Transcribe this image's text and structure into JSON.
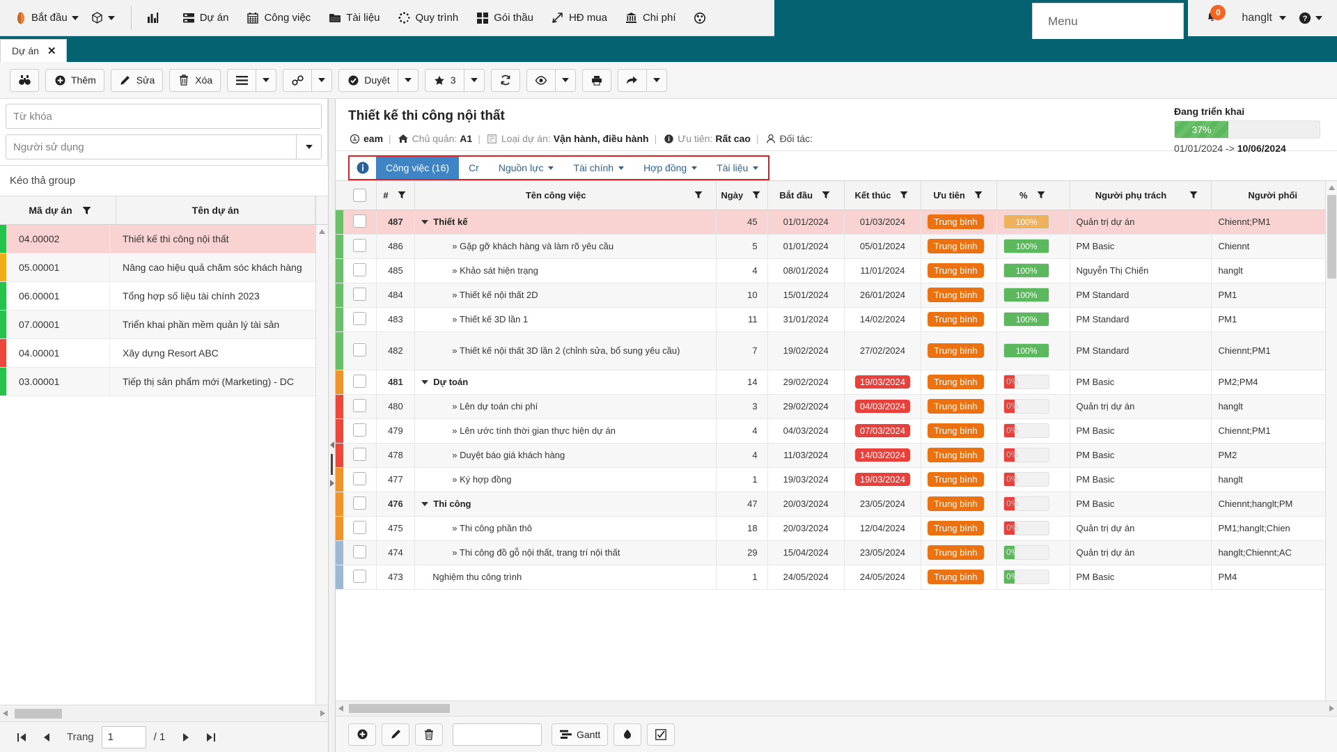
{
  "topnav": {
    "start_label": "Bắt đầu",
    "cube_label": "",
    "items": [
      {
        "label": "",
        "icon": "bar-chart-icon",
        "name": "nav-item-dashboard"
      },
      {
        "label": "Dự án",
        "icon": "projects-icon",
        "name": "nav-item-projects"
      },
      {
        "label": "Công việc",
        "icon": "calendar-icon",
        "name": "nav-item-tasks"
      },
      {
        "label": "Tài liệu",
        "icon": "folder-icon",
        "name": "nav-item-documents"
      },
      {
        "label": "Quy trình",
        "icon": "process-icon",
        "name": "nav-item-process"
      },
      {
        "label": "Gói thầu",
        "icon": "grid-icon",
        "name": "nav-item-packages"
      },
      {
        "label": "HĐ mua",
        "icon": "contract-icon",
        "name": "nav-item-purchase"
      },
      {
        "label": "Chi phí",
        "icon": "bank-icon",
        "name": "nav-item-cost"
      },
      {
        "label": "",
        "icon": "gauge-icon",
        "name": "nav-item-gauge"
      }
    ],
    "menu_label": "Menu",
    "notification_count": "0",
    "user": "hanglt"
  },
  "doc_tab": {
    "label": "Dự án",
    "close": "✕"
  },
  "toolbar": {
    "search_icon": "binoculars-icon",
    "add_label": "Thêm",
    "edit_label": "Sửa",
    "delete_label": "Xóa",
    "approve_label": "Duyệt",
    "star_count": "3"
  },
  "left": {
    "keyword_placeholder": "Từ khóa",
    "keyword_value": "",
    "user_placeholder": "Người sử dụng",
    "user_value": "",
    "group_hint": "Kéo thả group",
    "columns": [
      "Mã dự án",
      "Tên dự án"
    ],
    "rows": [
      {
        "code": "04.00002",
        "name": "Thiết kế thi công nội thất",
        "bar": "#27c24c",
        "selected": true
      },
      {
        "code": "05.00001",
        "name": "Nâng cao hiệu quả chăm sóc khách hàng",
        "bar": "#f0ad17",
        "selected": false
      },
      {
        "code": "06.00001",
        "name": "Tổng hợp số liệu tài chính 2023",
        "bar": "#27c24c",
        "selected": false
      },
      {
        "code": "07.00001",
        "name": "Triển khai phần mềm quản lý tài sản",
        "bar": "#27c24c",
        "selected": false
      },
      {
        "code": "04.00001",
        "name": "Xây dựng Resort ABC",
        "bar": "#e8493a",
        "selected": false
      },
      {
        "code": "03.00001",
        "name": "Tiếp thị sản phẩm mới (Marketing) - DC",
        "bar": "#27c24c",
        "selected": false
      }
    ],
    "pager": {
      "label": "Trang",
      "page": "1",
      "total": "/ 1"
    }
  },
  "project": {
    "title": "Thiết kế thi công nội thất",
    "team": "eam",
    "owner_label": "Chủ quản:",
    "owner": "A1",
    "type_label": "Loại dự án:",
    "type": "Vận hành, điều hành",
    "priority_label": "Ưu tiên:",
    "priority": "Rất cao",
    "partner_label": "Đối tác:",
    "partner": "",
    "status_title": "Đang triển khai",
    "progress": "37%",
    "progress_value": 37,
    "date_start": "01/01/2024",
    "date_arrow": "->",
    "date_end": "10/06/2024"
  },
  "subtabs": [
    {
      "label": "Công việc (16)",
      "active": true,
      "caret": false,
      "name": "tab-tasks"
    },
    {
      "label": "Cr",
      "active": false,
      "caret": false,
      "name": "tab-cr"
    },
    {
      "label": "Nguồn lực",
      "active": false,
      "caret": true,
      "name": "tab-resources"
    },
    {
      "label": "Tài chính",
      "active": false,
      "caret": true,
      "name": "tab-finance"
    },
    {
      "label": "Hợp đồng",
      "active": false,
      "caret": true,
      "name": "tab-contracts"
    },
    {
      "label": "Tài liệu",
      "active": false,
      "caret": true,
      "name": "tab-documents"
    }
  ],
  "grid": {
    "columns": [
      {
        "label": "#",
        "filter": true
      },
      {
        "label": "Tên công việc",
        "filter": true
      },
      {
        "label": "Ngày",
        "filter": true
      },
      {
        "label": "Bắt đầu",
        "filter": true
      },
      {
        "label": "Kết thúc",
        "filter": true
      },
      {
        "label": "Ưu tiên",
        "filter": true
      },
      {
        "label": "%",
        "filter": true
      },
      {
        "label": "Người phụ trách",
        "filter": true
      },
      {
        "label": "Người phối",
        "filter": false
      }
    ],
    "rows": [
      {
        "bar": "#6ac06a",
        "num": "487",
        "name": "Thiết kế",
        "level": "group",
        "days": "45",
        "start": "01/01/2024",
        "end": "01/03/2024",
        "end_late": false,
        "priority": "Trung bình",
        "pct": "100%",
        "pct_style": "amber",
        "resp": "Quản trị dự án",
        "coord": "Chiennt;PM1",
        "selected": true
      },
      {
        "bar": "#6ac06a",
        "num": "486",
        "name": "» Gặp gỡ khách hàng và làm rõ yêu cầu",
        "level": "sub",
        "days": "5",
        "start": "01/01/2024",
        "end": "05/01/2024",
        "end_late": false,
        "priority": "Trung bình",
        "pct": "100%",
        "pct_style": "full",
        "resp": "PM Basic",
        "coord": "Chiennt",
        "alt": true
      },
      {
        "bar": "#6ac06a",
        "num": "485",
        "name": "» Khảo sát hiện trạng",
        "level": "sub",
        "days": "4",
        "start": "08/01/2024",
        "end": "11/01/2024",
        "end_late": false,
        "priority": "Trung bình",
        "pct": "100%",
        "pct_style": "full",
        "resp": "Nguyễn Thị Chiến",
        "coord": "hanglt"
      },
      {
        "bar": "#6ac06a",
        "num": "484",
        "name": "» Thiết kế nội thất 2D",
        "level": "sub",
        "days": "10",
        "start": "15/01/2024",
        "end": "26/01/2024",
        "end_late": false,
        "priority": "Trung bình",
        "pct": "100%",
        "pct_style": "full",
        "resp": "PM Standard",
        "coord": "PM1",
        "alt": true
      },
      {
        "bar": "#6ac06a",
        "num": "483",
        "name": "» Thiết kế 3D lần 1",
        "level": "sub",
        "days": "11",
        "start": "31/01/2024",
        "end": "14/02/2024",
        "end_late": false,
        "priority": "Trung bình",
        "pct": "100%",
        "pct_style": "full",
        "resp": "PM Standard",
        "coord": "PM1"
      },
      {
        "bar": "#6ac06a",
        "num": "482",
        "name": "» Thiết kế nội thất 3D lần 2 (chỉnh sửa, bổ sung yêu cầu)",
        "level": "sub",
        "days": "7",
        "start": "19/02/2024",
        "end": "27/02/2024",
        "end_late": false,
        "priority": "Trung bình",
        "pct": "100%",
        "pct_style": "full",
        "resp": "PM Standard",
        "coord": "Chiennt;PM1",
        "alt": true,
        "tall": true
      },
      {
        "bar": "#f0932b",
        "num": "481",
        "name": "Dự toán",
        "level": "group",
        "days": "14",
        "start": "29/02/2024",
        "end": "19/03/2024",
        "end_late": true,
        "priority": "Trung bình",
        "pct": "0%",
        "pct_style": "zero",
        "resp": "PM Basic",
        "coord": "PM2;PM4"
      },
      {
        "bar": "#e8493a",
        "num": "480",
        "name": "» Lên dự toán chi phí",
        "level": "sub",
        "days": "3",
        "start": "29/02/2024",
        "end": "04/03/2024",
        "end_late": true,
        "priority": "Trung bình",
        "pct": "0%",
        "pct_style": "zero",
        "resp": "Quản trị dự án",
        "coord": "hanglt",
        "alt": true
      },
      {
        "bar": "#e8493a",
        "num": "479",
        "name": "» Lên ước tính thời gian thực hiện dự án",
        "level": "sub",
        "days": "4",
        "start": "04/03/2024",
        "end": "07/03/2024",
        "end_late": true,
        "priority": "Trung bình",
        "pct": "0%",
        "pct_style": "zero",
        "resp": "PM Basic",
        "coord": "Chiennt;PM1"
      },
      {
        "bar": "#e8493a",
        "num": "478",
        "name": "» Duyệt báo giá khách hàng",
        "level": "sub",
        "days": "4",
        "start": "11/03/2024",
        "end": "14/03/2024",
        "end_late": true,
        "priority": "Trung bình",
        "pct": "0%",
        "pct_style": "zero",
        "resp": "PM Basic",
        "coord": "PM2",
        "alt": true
      },
      {
        "bar": "#f0932b",
        "num": "477",
        "name": "» Ký hợp đồng",
        "level": "sub",
        "days": "1",
        "start": "19/03/2024",
        "end": "19/03/2024",
        "end_late": true,
        "priority": "Trung bình",
        "pct": "0%",
        "pct_style": "zero",
        "resp": "PM Basic",
        "coord": "hanglt"
      },
      {
        "bar": "#f0932b",
        "num": "476",
        "name": "Thi công",
        "level": "group",
        "days": "47",
        "start": "20/03/2024",
        "end": "23/05/2024",
        "end_late": false,
        "priority": "Trung bình",
        "pct": "0%",
        "pct_style": "zero",
        "resp": "PM Basic",
        "coord": "Chiennt;hanglt;PM",
        "alt": true
      },
      {
        "bar": "#f0932b",
        "num": "475",
        "name": "» Thi công phần thô",
        "level": "sub",
        "days": "18",
        "start": "20/03/2024",
        "end": "12/04/2024",
        "end_late": false,
        "priority": "Trung bình",
        "pct": "0%",
        "pct_style": "zero",
        "resp": "Quản trị dự án",
        "coord": "PM1;hanglt;Chien"
      },
      {
        "bar": "#9db8d2",
        "num": "474",
        "name": "» Thi công đồ gỗ nội thất, trang trí nội thất",
        "level": "sub",
        "days": "29",
        "start": "15/04/2024",
        "end": "23/05/2024",
        "end_late": false,
        "priority": "Trung bình",
        "pct": "0%",
        "pct_style": "green-zero",
        "resp": "Quản trị dự án",
        "coord": "hanglt;Chiennt;AC",
        "alt": true
      },
      {
        "bar": "#9db8d2",
        "num": "473",
        "name": "Nghiệm thu công trình",
        "level": "plain",
        "days": "1",
        "start": "24/05/2024",
        "end": "24/05/2024",
        "end_late": false,
        "priority": "Trung bình",
        "pct": "0%",
        "pct_style": "green-zero",
        "resp": "PM Basic",
        "coord": "PM4"
      }
    ]
  },
  "footer": {
    "add_icon": "add-circle-icon",
    "edit_icon": "pencil-icon",
    "delete_icon": "trash-icon",
    "search_value": "",
    "gantt_label": "Gantt",
    "upload_icon": "cloud-upload-icon",
    "check_icon": "checkbox-icon"
  },
  "colors": {
    "accent_teal": "#056271",
    "tab_blue": "#3f85c6",
    "orange": "#ec7211",
    "red": "#e8403a",
    "green": "#5cb85c",
    "highlight_border": "#e02020"
  }
}
